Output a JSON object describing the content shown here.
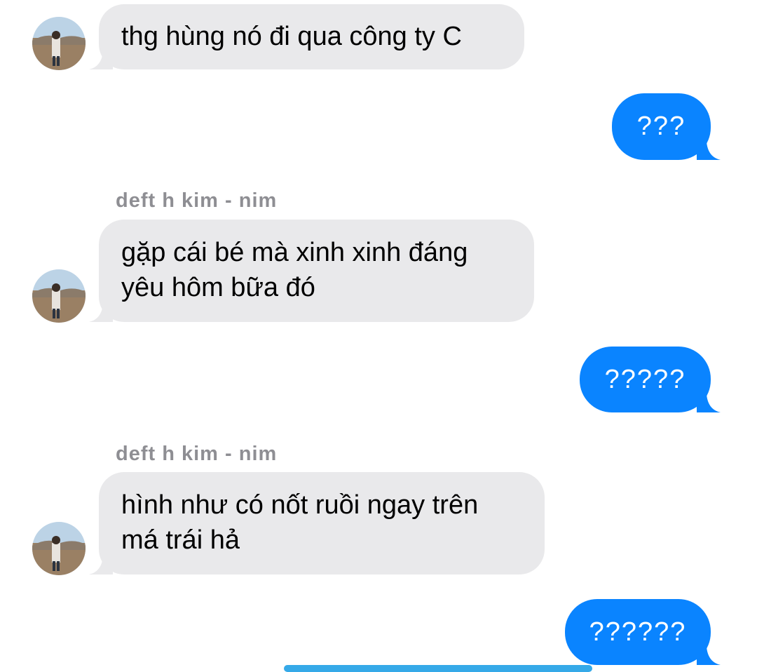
{
  "conversation": {
    "messages": [
      {
        "direction": "received",
        "text": "thg hùng nó đi qua công ty C"
      },
      {
        "direction": "sent",
        "text": "???"
      },
      {
        "direction": "received",
        "sender": "deft h kim - nim",
        "lines": [
          "gặp cái bé mà xinh xinh đáng",
          "yêu hôm bữa đó"
        ]
      },
      {
        "direction": "sent",
        "text": "?????"
      },
      {
        "direction": "received",
        "sender": "deft h kim - nim",
        "lines": [
          "hình như có nốt ruồi ngay trên",
          "má trái hả"
        ]
      },
      {
        "direction": "sent",
        "text": "??????"
      }
    ]
  },
  "colors": {
    "received_bubble": "#e9e9eb",
    "sent_bubble": "#0a84ff",
    "sender_name": "#8e8e93"
  },
  "icons": {
    "avatar": "avatar-photo"
  }
}
